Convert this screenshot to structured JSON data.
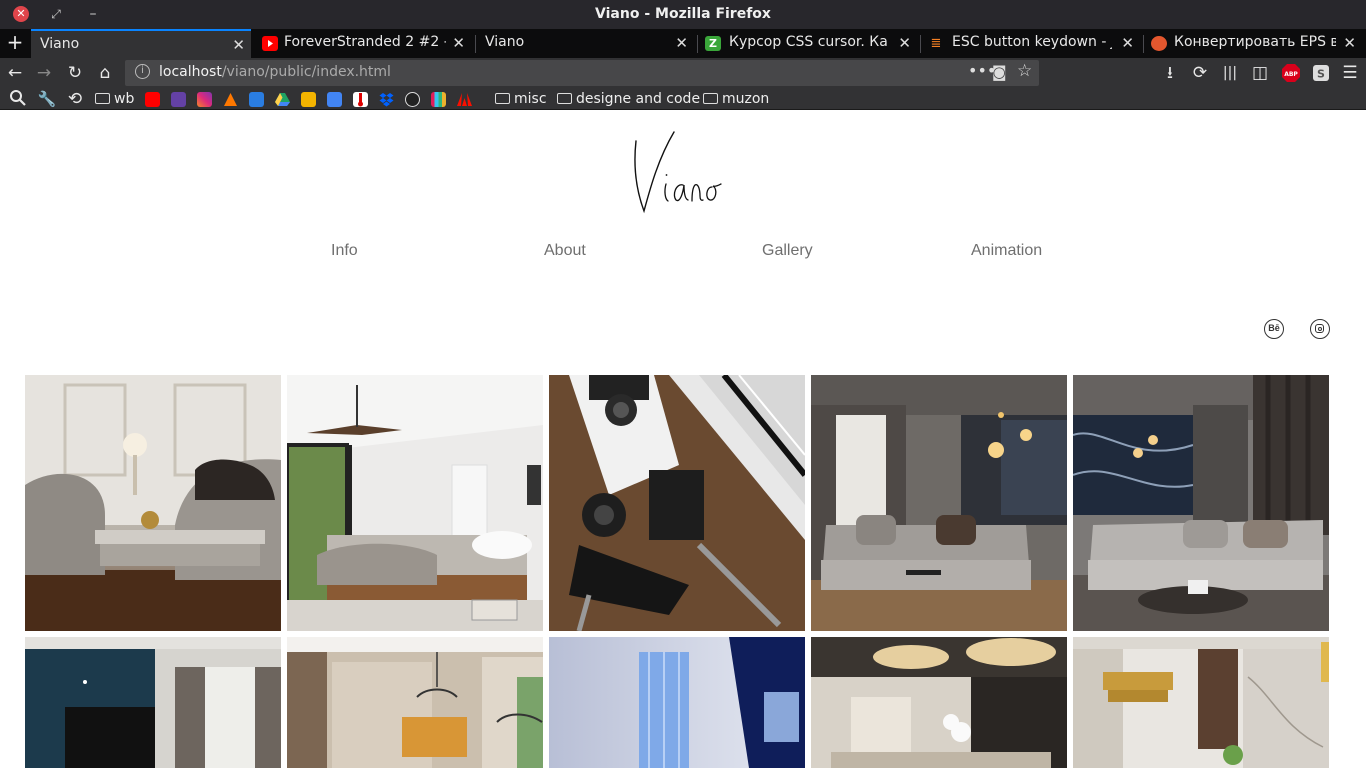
{
  "window": {
    "title": "Viano - Mozilla Firefox"
  },
  "tabs": [
    {
      "label": "Viano",
      "active": true
    },
    {
      "label": "ForeverStranded 2 #2 - F",
      "icon": "youtube-icon"
    },
    {
      "label": "Viano"
    },
    {
      "label": "Курсор CSS cursor. Как с",
      "icon": "green-z-icon"
    },
    {
      "label": "ESC button keydown - Ja",
      "icon": "stack-overflow-icon"
    },
    {
      "label": "Конвертировать EPS в E",
      "icon": "convertio-icon"
    }
  ],
  "urlbar": {
    "host": "localhost",
    "path": "/viano/public/index.html"
  },
  "bookmarks": {
    "wb": "wb",
    "misc": "misc",
    "designe": "designe and code",
    "muzon": "muzon"
  },
  "page": {
    "logo_text": "Viano",
    "nav": [
      "Info",
      "About",
      "Gallery",
      "Animation"
    ],
    "social": {
      "behance": "Bē",
      "instagram": ""
    }
  },
  "colors": {
    "accent": "#0a84ff",
    "nav_text": "#6f6f6f"
  }
}
